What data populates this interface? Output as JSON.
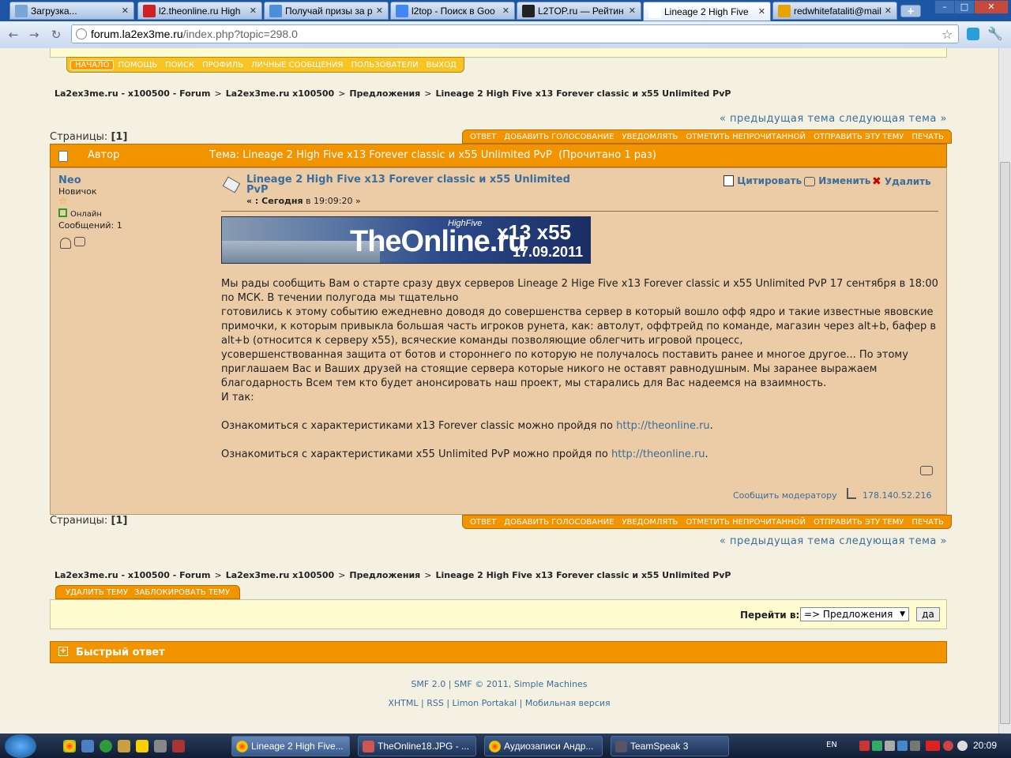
{
  "browser": {
    "tabs": [
      {
        "label": "Загрузка...",
        "fav": "#7aa6d6"
      },
      {
        "label": "l2.theonline.ru High",
        "fav": "#cc2222"
      },
      {
        "label": "Получай призы за р",
        "fav": "#4a8fd8"
      },
      {
        "label": "l2top - Поиск в Goo",
        "fav": "#4285f4"
      },
      {
        "label": "L2TOP.ru — Рейтин",
        "fav": "#222222"
      },
      {
        "label": "Lineage 2 High Five",
        "fav": "#ffffff"
      },
      {
        "label": "redwhitefataliti@mail",
        "fav": "#e7a400"
      }
    ],
    "url_host": "forum.la2ex3me.ru",
    "url_path": "/index.php?topic=298.0"
  },
  "menu": {
    "items": [
      "НАЧАЛО",
      "ПОМОЩЬ",
      "ПОИСК",
      "ПРОФИЛЬ",
      "ЛИЧНЫЕ СООБЩЕНИЯ",
      "ПОЛЬЗОВАТЕЛИ",
      "ВЫХОД"
    ]
  },
  "breadcrumb": {
    "items": [
      "La2ex3me.ru - x100500 - Forum",
      "La2ex3me.ru x100500",
      "Предложения",
      "Lineage 2 High Five x13 Forever classic и x55 Unlimited PvP"
    ],
    "sep": ">"
  },
  "topic_nav": "« предыдущая тема следующая тема »",
  "pages": {
    "label": "Страницы:",
    "value": "[1]"
  },
  "topic_buttons": [
    "ОТВЕТ",
    "ДОБАВИТЬ ГОЛОСОВАНИЕ",
    "УВЕДОМЛЯТЬ",
    "ОТМЕТИТЬ НЕПРОЧИТАННОЙ",
    "ОТПРАВИТЬ ЭТУ ТЕМУ",
    "ПЕЧАТЬ"
  ],
  "header": {
    "author_label": "Автор",
    "topic_text": "Тема: Lineage 2 High Five x13 Forever classic и x55 Unlimited PvP  (Прочитано 1 раз)"
  },
  "poster": {
    "name": "Neo",
    "rank": "Новичок",
    "status": "Онлайн",
    "posts": "Сообщений: 1"
  },
  "post": {
    "title": "Lineage 2 High Five x13 Forever classic и x55 Unlimited PvP",
    "date_prefix": "« : ",
    "date_bold": "Сегодня",
    "date_rest": " в 19:09:20 »",
    "actions": [
      "Цитировать",
      "Изменить",
      "Удалить"
    ],
    "banner": {
      "brand": "TheOnline.ru",
      "tag": "HighFive",
      "rates": "x13 x55",
      "date": "17.09.2011"
    },
    "body": [
      "Мы рады сообщить Вам о старте сразу двух серверов Lineage 2 Hige Five x13 Forever classic и x55 Unlimited PvP 17 сентября в 18:00 по МСК. В течении полугода мы тщательно",
      "готовились к этому событию ежедневно доводя до совершенства сервер в который вошло офф ядро и такие известные явовские примочки, к которым привыкла большая часть игроков рунета, как: автолут, оффтрейд по команде, магазин через alt+b, бафер в alt+b (относится к серверу x55), всяческие команды позволяющие облегчить игровой процесс,",
      "усовершенствованная защита от ботов и стороннего по которую не получалось поставить ранее и многое другое... По этому приглашаем Вас и Ваших друзей на стоящие сервера которые никого не оставят равнодушным. Мы заранее выражаем благодарность Всем тем кто будет анонсировать наш проект, мы старались для Вас надеемся на взаимность.",
      "И так:"
    ],
    "link1_text": "Ознакомиться с характеристиками x13 Forever classic можно пройдя по ",
    "link1": "http://theonline.ru",
    "link2_text": "Ознакомиться с характеристиками x55 Unlimited PvP можно пройдя по ",
    "link2": "http://theonline.ru",
    "report": "Сообщить модератору",
    "ip": "178.140.52.216"
  },
  "mod_buttons": [
    "УДАЛИТЬ ТЕМУ",
    "ЗАБЛОКИРОВАТЬ ТЕМУ"
  ],
  "jump": {
    "label": "Перейти в:",
    "value": "=> Предложения",
    "go": "да"
  },
  "quick_reply": "Быстрый ответ",
  "footer": {
    "line1": "SMF 2.0 | SMF © 2011, Simple Machines",
    "line2": "XHTML | RSS | Limon Portakal | Мобильная версия"
  },
  "taskbar": {
    "tasks": [
      "Lineage 2 High Five...",
      "TheOnline18.JPG - ...",
      "Аудиозаписи Андр...",
      "TeamSpeak 3"
    ],
    "lang": "EN",
    "clock": "20:09"
  }
}
